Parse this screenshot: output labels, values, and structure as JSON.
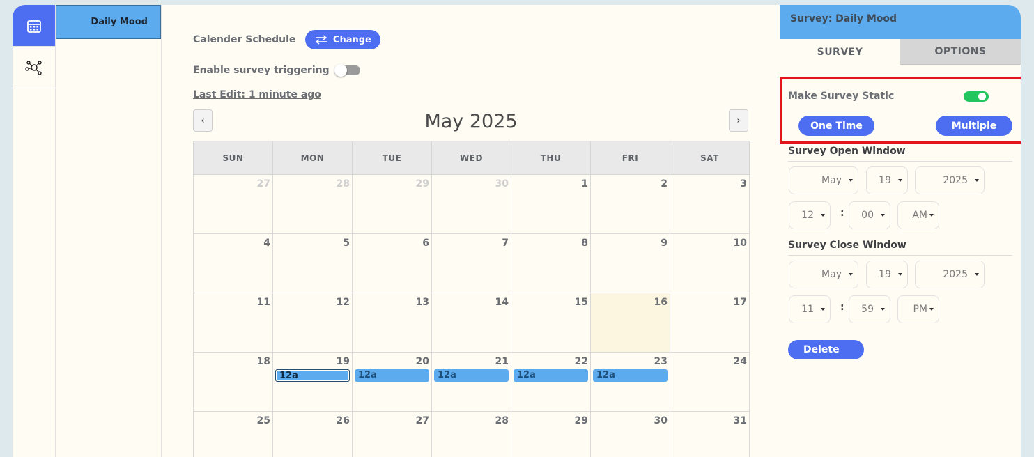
{
  "rail": {
    "items": [
      {
        "icon": "calendar-icon",
        "active": true
      },
      {
        "icon": "network-graph-icon",
        "active": false
      }
    ]
  },
  "survey_list": {
    "items": [
      "Daily Mood"
    ]
  },
  "schedule": {
    "type_label": "Calender Schedule",
    "change_label": "Change",
    "trigger_label": "Enable survey triggering",
    "trigger_enabled": false,
    "last_edit": "Last Edit: 1 minute ago"
  },
  "calendar": {
    "month_title": "May 2025",
    "prev_label": "‹",
    "next_label": "›",
    "weekdays": [
      "SUN",
      "MON",
      "TUE",
      "WED",
      "THU",
      "FRI",
      "SAT"
    ],
    "weeks": [
      [
        {
          "d": "27",
          "other": true
        },
        {
          "d": "28",
          "other": true
        },
        {
          "d": "29",
          "other": true
        },
        {
          "d": "30",
          "other": true
        },
        {
          "d": "1"
        },
        {
          "d": "2"
        },
        {
          "d": "3"
        }
      ],
      [
        {
          "d": "4"
        },
        {
          "d": "5"
        },
        {
          "d": "6"
        },
        {
          "d": "7"
        },
        {
          "d": "8"
        },
        {
          "d": "9"
        },
        {
          "d": "10"
        }
      ],
      [
        {
          "d": "11"
        },
        {
          "d": "12"
        },
        {
          "d": "13"
        },
        {
          "d": "14"
        },
        {
          "d": "15"
        },
        {
          "d": "16",
          "today": true
        },
        {
          "d": "17"
        }
      ],
      [
        {
          "d": "18"
        },
        {
          "d": "19",
          "event": "12a",
          "selected": true
        },
        {
          "d": "20",
          "event": "12a"
        },
        {
          "d": "21",
          "event": "12a"
        },
        {
          "d": "22",
          "event": "12a"
        },
        {
          "d": "23",
          "event": "12a"
        },
        {
          "d": "24"
        }
      ],
      [
        {
          "d": "25"
        },
        {
          "d": "26"
        },
        {
          "d": "27"
        },
        {
          "d": "28"
        },
        {
          "d": "29"
        },
        {
          "d": "30"
        },
        {
          "d": "31"
        }
      ]
    ]
  },
  "panel": {
    "title": "Survey: Daily Mood",
    "tabs": [
      {
        "label": "SURVEY",
        "active": true
      },
      {
        "label": "OPTIONS",
        "active": false
      }
    ],
    "static_label": "Make Survey Static",
    "static_enabled": true,
    "one_time_label": "One Time",
    "multiple_label": "Multiple",
    "open_window": {
      "title": "Survey Open Window",
      "month": "May",
      "day": "19",
      "year": "2025",
      "hour": "12",
      "minute": "00",
      "ampm": "AM"
    },
    "close_window": {
      "title": "Survey Close Window",
      "month": "May",
      "day": "19",
      "year": "2025",
      "hour": "11",
      "minute": "59",
      "ampm": "PM"
    },
    "delete_label": "Delete",
    "time_separator": ":"
  },
  "colors": {
    "accent": "#4e6ef2",
    "header_blue": "#5cabee",
    "toggle_on": "#22c55e",
    "highlight_border": "#e3141b"
  }
}
